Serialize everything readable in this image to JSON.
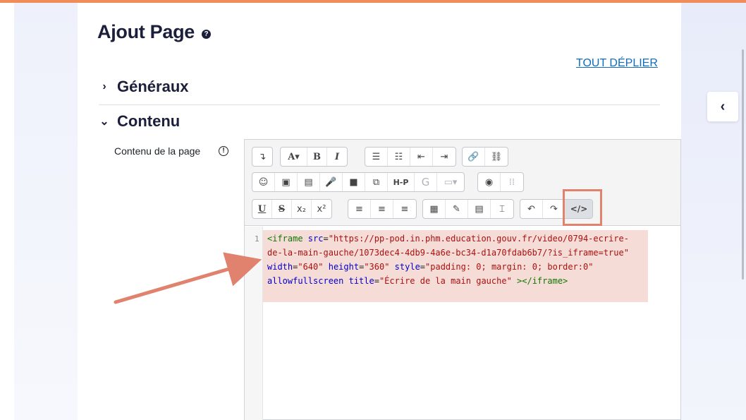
{
  "page": {
    "title": "Ajout Page",
    "help_icon": "?",
    "expand_all": "TOUT DÉPLIER"
  },
  "sections": [
    {
      "label": "Généraux",
      "expanded": false
    },
    {
      "label": "Contenu",
      "expanded": true
    }
  ],
  "field": {
    "label": "Contenu de la page",
    "info_icon": "!"
  },
  "toolbar": {
    "row1": {
      "g1": [
        "↴"
      ],
      "g2": [
        "A▾",
        "B",
        "I"
      ],
      "g3": [
        "☰",
        "☷",
        "⇤",
        "⇥"
      ],
      "g4": [
        "🔗",
        "⛓"
      ]
    },
    "row2": {
      "g1": [
        "☺",
        "▣",
        "▤",
        "🎤",
        "■",
        "⧉",
        "H-P",
        "G",
        "▭▾"
      ],
      "g2": [
        "◉",
        "⁞⁞"
      ]
    },
    "row3": {
      "g1": [
        "U",
        "S",
        "x₂",
        "x²"
      ],
      "g2": [
        "≡",
        "≡",
        "≡"
      ],
      "g3": [
        "▦",
        "✎",
        "▤",
        "⌶"
      ],
      "g4": [
        "↶",
        "↷",
        "</>"
      ]
    }
  },
  "code": {
    "line_number": "1",
    "lines": [
      [
        {
          "t": "tag",
          "v": "<iframe "
        },
        {
          "t": "attr",
          "v": "src"
        },
        {
          "t": "plain",
          "v": "="
        },
        {
          "t": "str",
          "v": "\"https://pp-pod.in.phm.education.gouv.fr/video/0794-ecrire-"
        }
      ],
      [
        {
          "t": "str",
          "v": "de-la-main-gauche/1073dec4-4db9-4a6e-bc34-d1a70fdab6b7/?is_iframe=true\""
        }
      ],
      [
        {
          "t": "attr",
          "v": "width"
        },
        {
          "t": "plain",
          "v": "="
        },
        {
          "t": "str",
          "v": "\"640\" "
        },
        {
          "t": "attr",
          "v": "height"
        },
        {
          "t": "plain",
          "v": "="
        },
        {
          "t": "str",
          "v": "\"360\" "
        },
        {
          "t": "attr",
          "v": "style"
        },
        {
          "t": "plain",
          "v": "="
        },
        {
          "t": "str",
          "v": "\"padding: 0; margin: 0; border:0\""
        }
      ],
      [
        {
          "t": "attr",
          "v": "allowfullscreen "
        },
        {
          "t": "attr",
          "v": "title"
        },
        {
          "t": "plain",
          "v": "="
        },
        {
          "t": "str",
          "v": "\"Écrire de la main gauche\""
        },
        {
          "t": "tag",
          "v": " ></iframe>"
        }
      ]
    ]
  },
  "drawer_toggle": "‹",
  "colors": {
    "accent_bar": "#f08c5a",
    "link": "#0f6cbf",
    "highlight": "#e0826e",
    "code_bg": "#f6dcd6"
  }
}
